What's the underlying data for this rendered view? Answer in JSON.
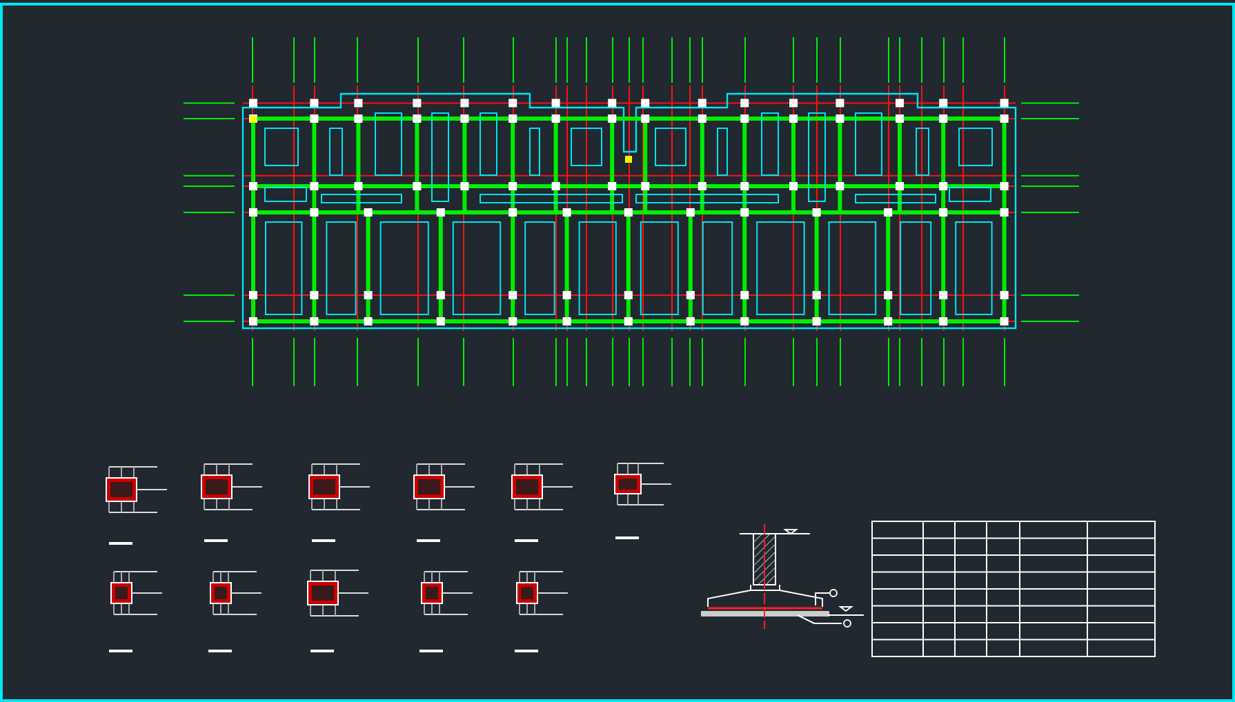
{
  "plan": {
    "kind": "foundation-plan"
  },
  "column_details": [
    {
      "kind": "wide"
    },
    {
      "kind": "wide"
    },
    {
      "kind": "wide"
    },
    {
      "kind": "wide"
    },
    {
      "kind": "wide"
    },
    {
      "kind": "small"
    },
    {
      "kind": "square"
    },
    {
      "kind": "square"
    },
    {
      "kind": "wide"
    },
    {
      "kind": "square"
    },
    {
      "kind": "square"
    }
  ],
  "section": {
    "kind": "footing"
  },
  "table": {
    "kind": "grid"
  }
}
